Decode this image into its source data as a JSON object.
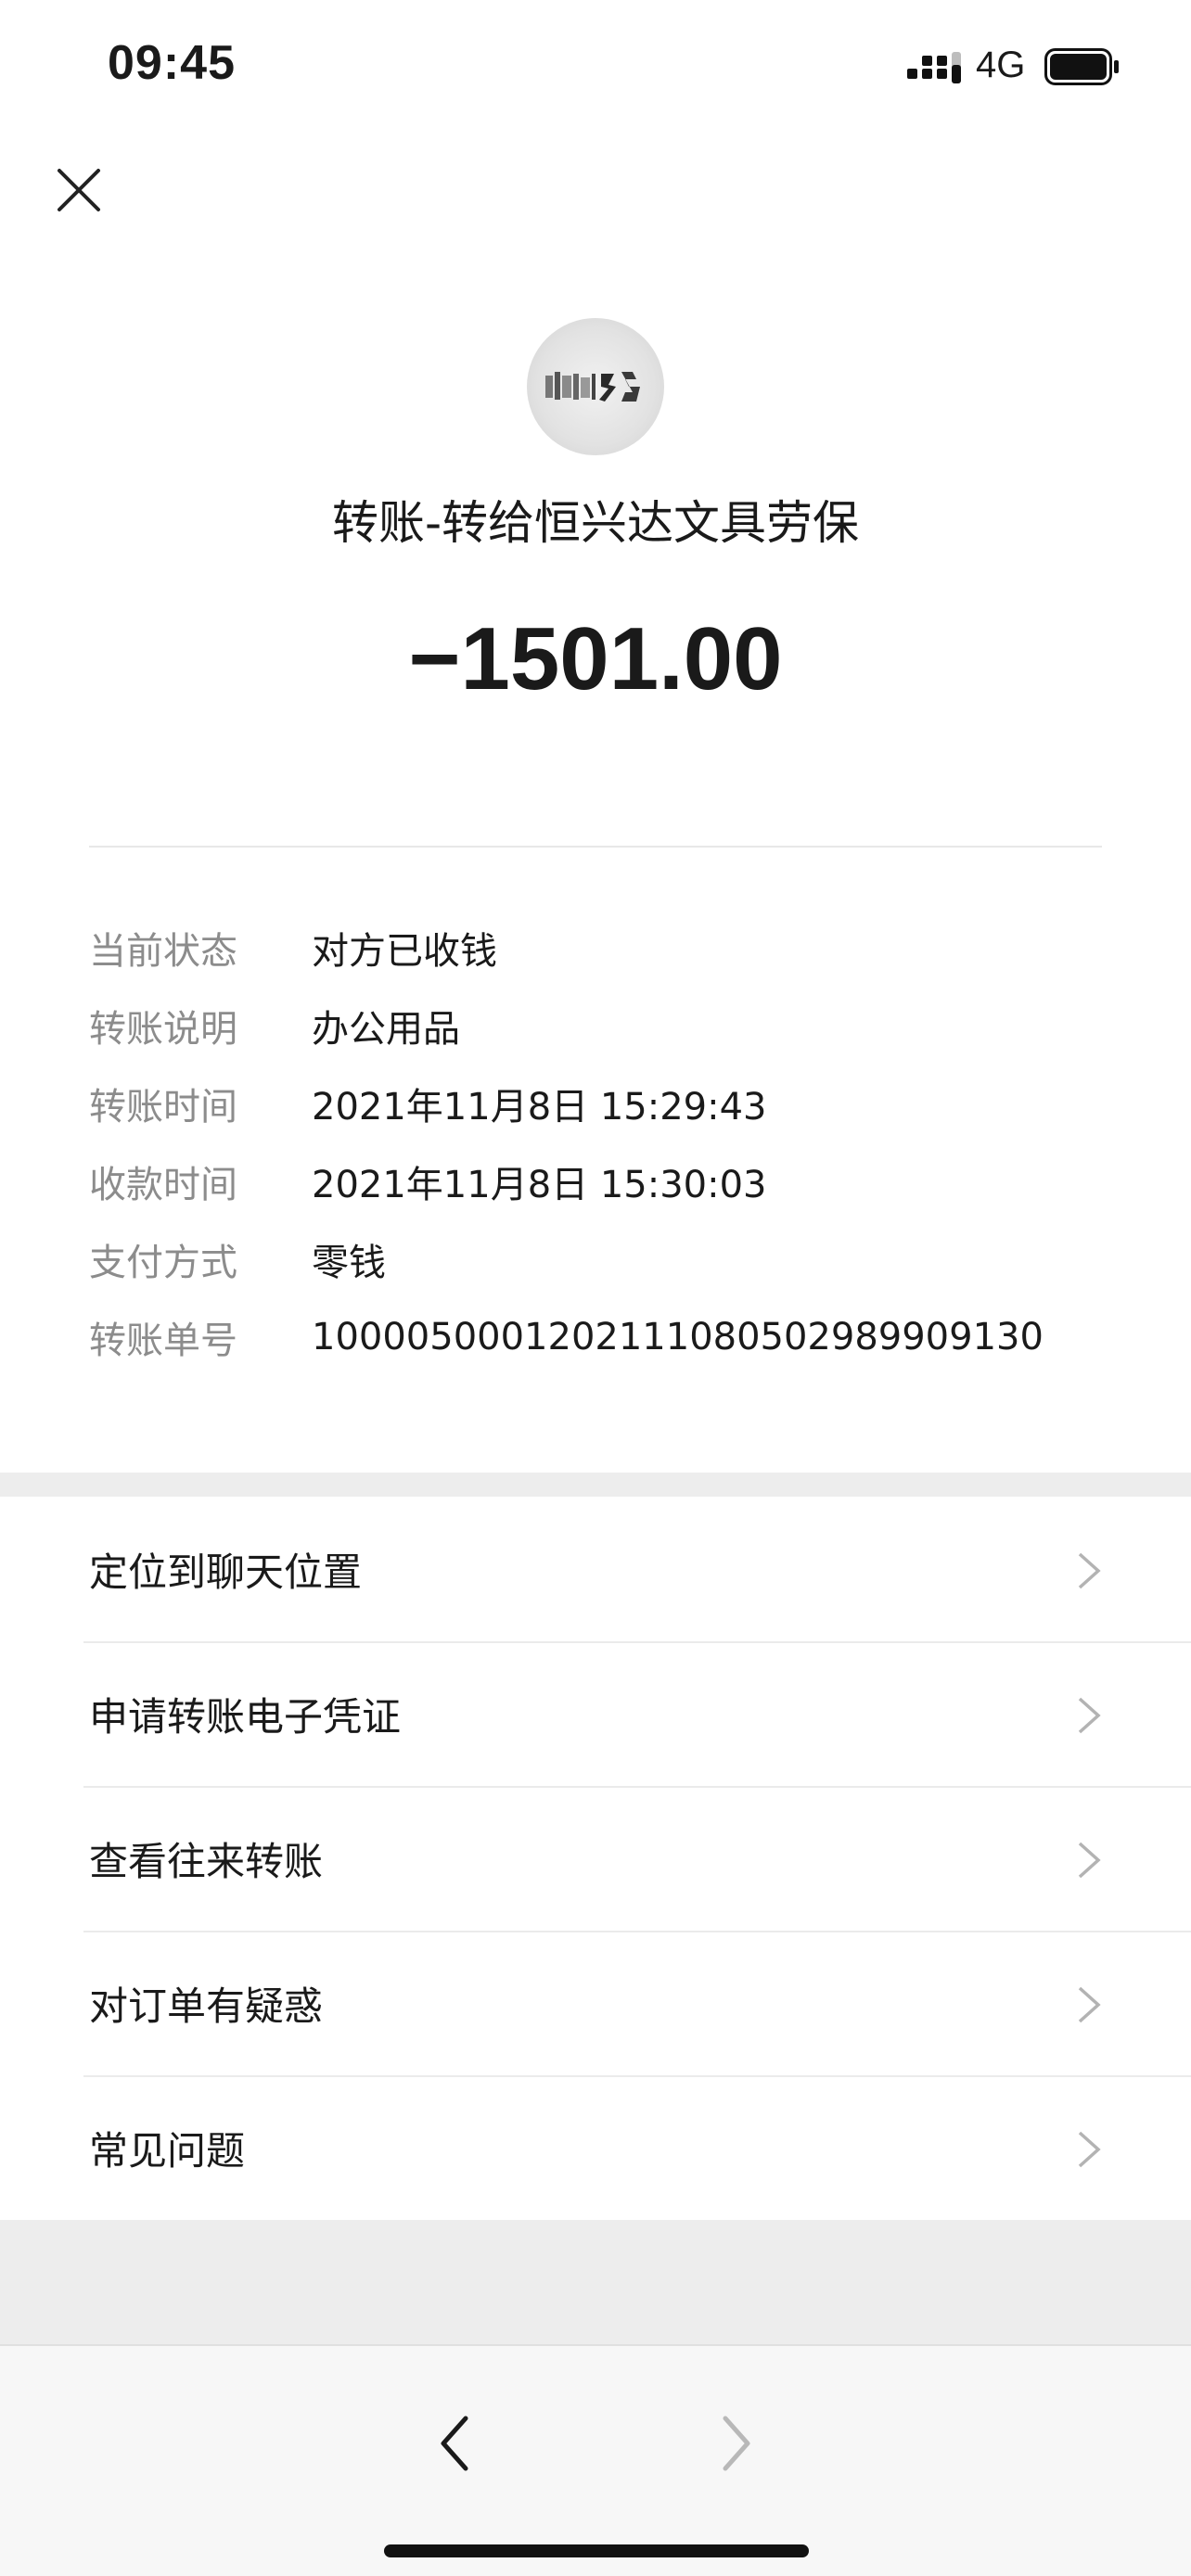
{
  "status_bar": {
    "time": "09:45",
    "network": "4G",
    "signal_icon": "signal-bars-icon",
    "battery_icon": "battery-full-icon"
  },
  "header": {
    "close_icon": "close-icon"
  },
  "transfer": {
    "title": "转账-转给恒兴达文具劳保",
    "amount": "−1501.00"
  },
  "details": [
    {
      "label": "当前状态",
      "value": "对方已收钱"
    },
    {
      "label": "转账说明",
      "value": "办公用品"
    },
    {
      "label": "转账时间",
      "value": "2021年11月8日 15:29:43"
    },
    {
      "label": "收款时间",
      "value": "2021年11月8日 15:30:03"
    },
    {
      "label": "支付方式",
      "value": "零钱"
    },
    {
      "label": "转账单号",
      "value": "1000050001202111080502989909130"
    }
  ],
  "menu": [
    {
      "label": "定位到聊天位置"
    },
    {
      "label": "申请转账电子凭证"
    },
    {
      "label": "查看往来转账"
    },
    {
      "label": "对订单有疑惑"
    },
    {
      "label": "常见问题"
    }
  ],
  "toolbar": {
    "back_icon": "chevron-left-icon",
    "forward_icon": "chevron-right-icon"
  },
  "colors": {
    "label_gray": "#8c8c8c",
    "separator": "#ededed",
    "text": "#1a1a1a"
  }
}
